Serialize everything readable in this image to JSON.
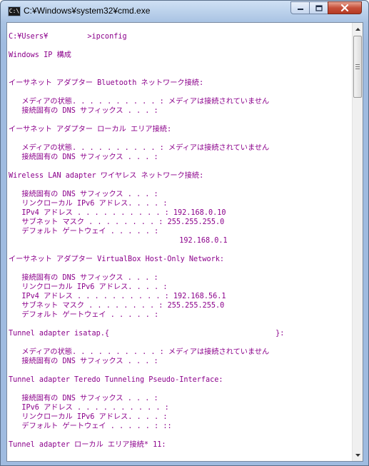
{
  "window": {
    "title": "C:¥Windows¥system32¥cmd.exe",
    "icon_label": "C:\\",
    "icon": "command-prompt-icon"
  },
  "controls": {
    "minimize": "minimize-icon",
    "maximize": "maximize-icon",
    "close": "close-icon"
  },
  "console": {
    "lines": [
      "",
      "C:¥Users¥         >ipconfig",
      "",
      "Windows IP 構成",
      "",
      "",
      "イーサネット アダプター Bluetooth ネットワーク接続:",
      "",
      "   メディアの状態. . . . . . . . . . : メディアは接続されていません",
      "   接続固有の DNS サフィックス . . . :",
      "",
      "イーサネット アダプター ローカル エリア接続:",
      "",
      "   メディアの状態. . . . . . . . . . : メディアは接続されていません",
      "   接続固有の DNS サフィックス . . . :",
      "",
      "Wireless LAN adapter ワイヤレス ネットワーク接続:",
      "",
      "   接続固有の DNS サフィックス . . . :",
      "   リンクローカル IPv6 アドレス. . . . :",
      "   IPv4 アドレス . . . . . . . . . . : 192.168.0.10",
      "   サブネット マスク . . . . . . . . : 255.255.255.0",
      "   デフォルト ゲートウェイ . . . . . :",
      "                                       192.168.0.1",
      "",
      "イーサネット アダプター VirtualBox Host-Only Network:",
      "",
      "   接続固有の DNS サフィックス . . . :",
      "   リンクローカル IPv6 アドレス. . . . :",
      "   IPv4 アドレス . . . . . . . . . . : 192.168.56.1",
      "   サブネット マスク . . . . . . . . : 255.255.255.0",
      "   デフォルト ゲートウェイ . . . . . :",
      "",
      "Tunnel adapter isatap.{                                      }:",
      "",
      "   メディアの状態. . . . . . . . . . : メディアは接続されていません",
      "   接続固有の DNS サフィックス . . . :",
      "",
      "Tunnel adapter Teredo Tunneling Pseudo-Interface:",
      "",
      "   接続固有の DNS サフィックス . . . :",
      "   IPv6 アドレス . . . . . . . . . . :",
      "   リンクローカル IPv6 アドレス. . . . :",
      "   デフォルト ゲートウェイ . . . . . : ::",
      "",
      "Tunnel adapter ローカル エリア接続* 11:",
      ""
    ]
  },
  "scrollbar": {
    "up": "scroll-up-arrow-icon",
    "down": "scroll-down-arrow-icon",
    "position_fraction": 0.0,
    "visible_fraction": 0.15
  },
  "colors": {
    "text": "#8b008b",
    "background": "#ffffff",
    "close_button": "#c7503a"
  }
}
